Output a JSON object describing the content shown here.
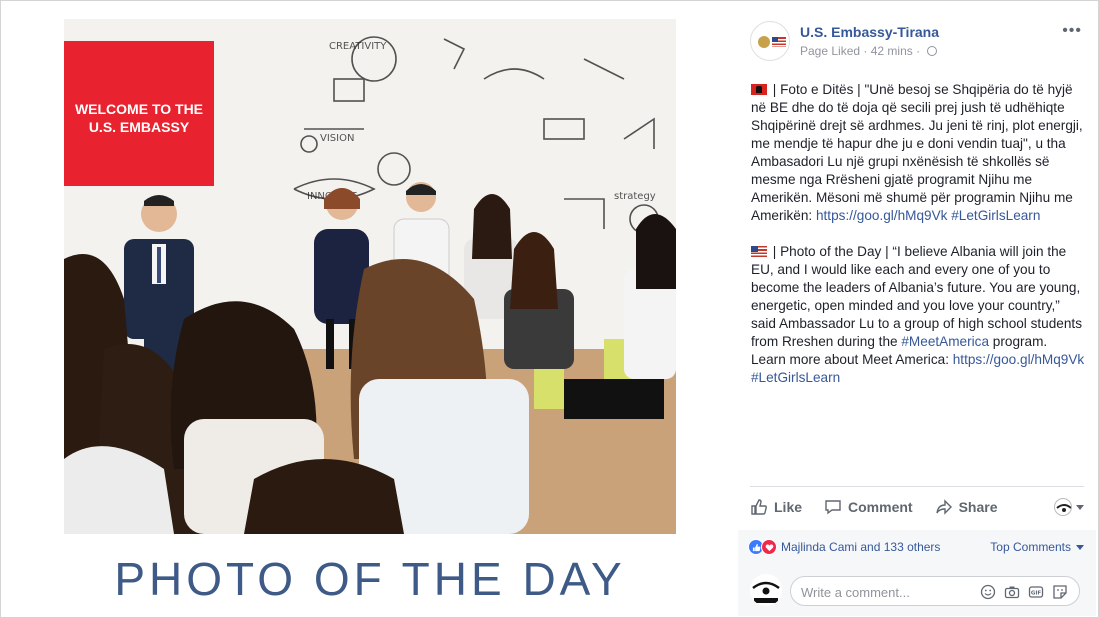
{
  "photo": {
    "screen_text": [
      "WELCOME TO THE",
      "U.S. EMBASSY"
    ],
    "caption": "PHOTO OF THE DAY"
  },
  "post": {
    "page_name": "U.S. Embassy-Tirana",
    "status": "Page Liked",
    "time": "42 mins",
    "paragraph_al_text": " | Foto e Ditës | \"Unë besoj se Shqipëria do të hyjë në BE dhe do të doja që secili prej jush të udhëhiqte Shqipërinë drejt së ardhmes. Ju jeni të rinj, plot energji, me mendje të hapur dhe ju e doni vendin tuaj\", u tha Ambasadori Lu një grupi nxënësish të shkollës së mesme nga Rrësheni gjatë programit Njihu me Amerikën. Mësoni më shumë për programin Njihu me Amerikën: ",
    "paragraph_al_link": "https://goo.gl/hMq9Vk",
    "paragraph_al_tag": "#LetGirlsLearn",
    "paragraph_en_text1": " | Photo of the Day | “I believe Albania will join the EU, and I would like each and every one of you to become the leaders of Albania’s future. You are young, energetic, open minded and you love your country,” said Ambassador Lu to a group of high school students from Rreshen during the ",
    "paragraph_en_hashtag": "#MeetAmerica",
    "paragraph_en_text2": " program. Learn more about Meet America: ",
    "paragraph_en_link": "https://goo.gl/hMq9Vk",
    "paragraph_en_tag": "#LetGirlsLearn"
  },
  "actions": {
    "like": "Like",
    "comment": "Comment",
    "share": "Share"
  },
  "comments": {
    "reactions_text": "Majlinda Cami and 133 others",
    "top_comments": "Top Comments",
    "placeholder": "Write a comment..."
  },
  "colors": {
    "link": "#365899",
    "caption": "#3e5a86",
    "screen_red": "#e8232f"
  }
}
